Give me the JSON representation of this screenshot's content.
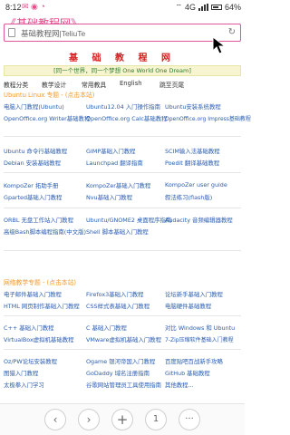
{
  "status_bar": {
    "time": "8:12",
    "network": "4G",
    "battery": "64%"
  },
  "page_header_title": "《基础教程网》",
  "url_bar": {
    "text": "基础教程网|TeliuTe"
  },
  "site_title": "基 础 教 程 网",
  "slogan": "[同一个世界，同一个梦想 One World One Dream]",
  "nav": [
    "教程分类",
    "教学设计",
    "常用教具",
    "English",
    "跳至页尾"
  ],
  "sections": [
    {
      "title": "Ubuntu Linux 专题 - (点击本站)",
      "rows": [
        [
          "电脑入门教程(Ubuntu)",
          "Ubuntu12.04 入门操作指南",
          "Ubuntu安装系统教程"
        ],
        [
          "OpenOffice.org Writer基础教程",
          "OpenOffice.org Calc基础教程",
          "OpenOffice.org Impress基础教程"
        ],
        [
          "Ubuntu 命令行基础教程",
          "GIMP基础入门教程",
          "SCIM输入法基础教程"
        ],
        [
          "Debian 安装基础教程",
          "Launchpad 翻译指南",
          "Poedit 翻译基础教程"
        ],
        [
          "KompoZer 拓助手册",
          "KompoZer基础入门教程",
          "KompoZer user guide"
        ],
        [
          "Gparted基础入门教程",
          "Nvu基础入门教程",
          "叙法练习(flash版)"
        ],
        [
          "ORBL 无盘工作站入门教程",
          "Ubuntu/GNOME2 桌面程序指南",
          "Audacity 音频编辑器教程"
        ],
        [
          "高级Bash脚本编程指南(中文版)",
          "Shell 脚本基础入门教程",
          ""
        ]
      ]
    },
    {
      "title": "网络教学专题 - (点击本站)",
      "rows": [
        [
          "电子邮件基础入门教程",
          "Firefox3基础入门教程",
          "论坛新手基础入门教程"
        ],
        [
          "HTML 网页制作基础入门教程",
          "CSS样式表基础入门教程",
          "电脑硬件基础教程"
        ],
        [
          "C++ 基础入门教程",
          "C 基础入门教程",
          "对比 Windows 和 Ubuntu"
        ],
        [
          "VirtualBox虚拟机基础教程",
          "VMware虚拟机基础入门教程",
          "7-Zip压缩软件基础入门教程"
        ],
        [
          "Oz/PW论坛安装教程",
          "Ogame 银河帝国入门教程",
          "百度贴吧百战新手攻略"
        ],
        [
          "图猎入门教程",
          "GoDaddy 域名注册指南",
          "GitHub 基础教程"
        ],
        [
          "太极拳入门学习",
          "谷歌网站管理员工具使用指南",
          "其他教程..."
        ]
      ]
    }
  ],
  "bottom_nav": {
    "back": "‹",
    "forward": "›",
    "add": "+",
    "tabs": "1",
    "menu": "···"
  },
  "colors": {
    "accent": "#e94b8b",
    "link": "#2a5db0",
    "title_red": "#d62020",
    "section_orange": "#f29a2e"
  }
}
